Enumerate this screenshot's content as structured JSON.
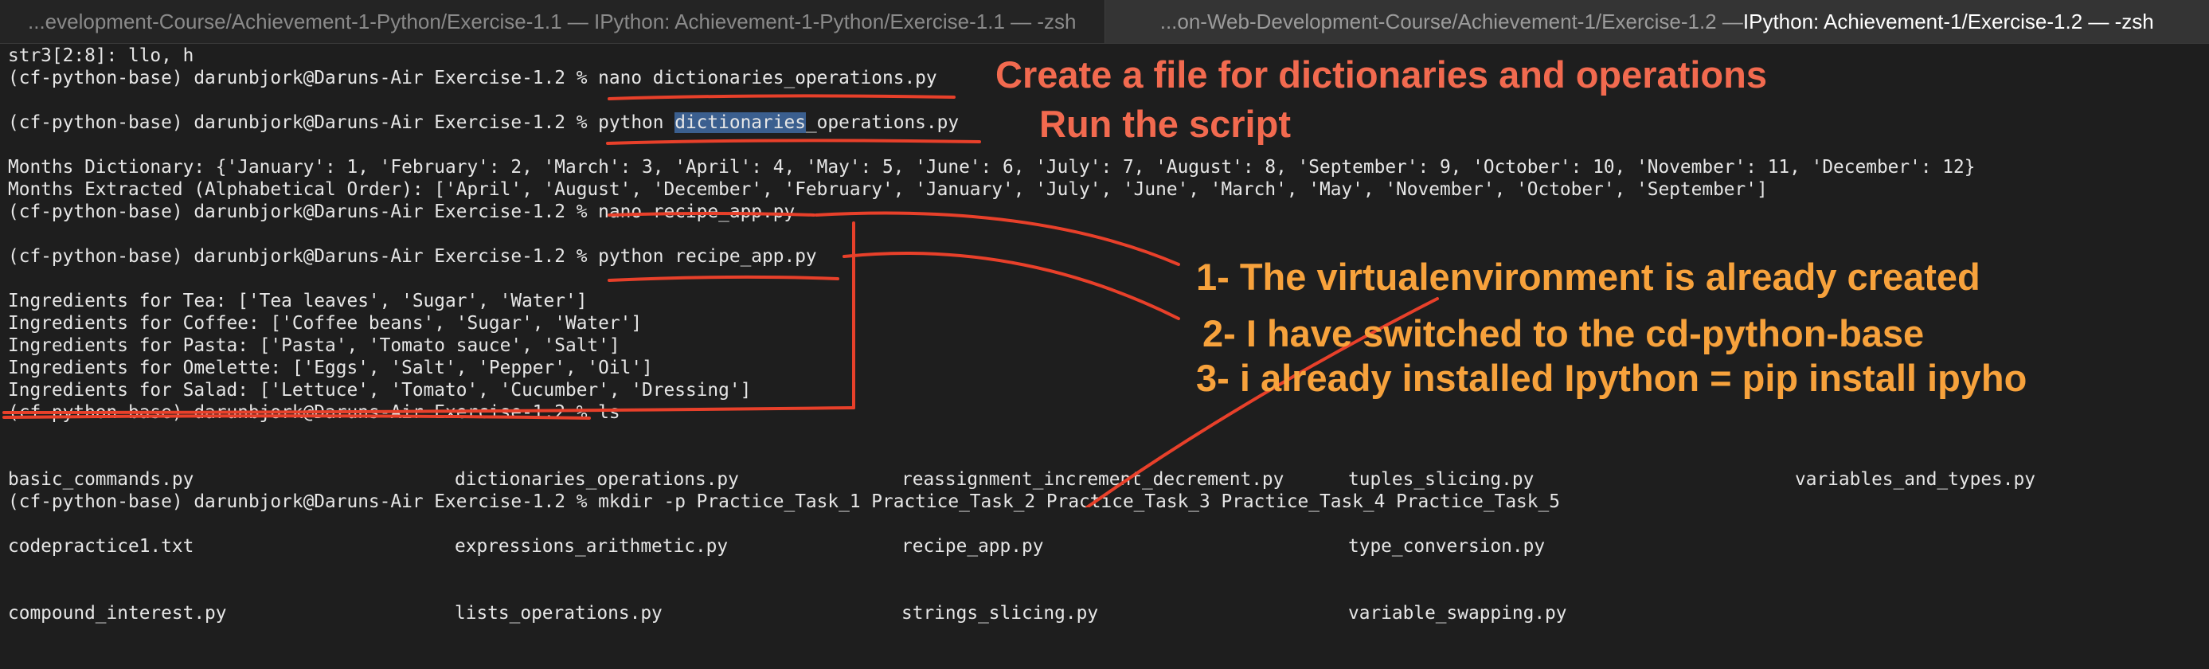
{
  "tabs": [
    {
      "label": "...evelopment-Course/Achievement-1-Python/Exercise-1.1 — IPython: Achievement-1-Python/Exercise-1.1 — -zsh",
      "active": false
    },
    {
      "label_prefix": "...on-Web-Development-Course/Achievement-1/Exercise-1.2 — ",
      "label_main": "IPython: Achievement-1/Exercise-1.2 — -zsh",
      "active": true
    }
  ],
  "terminal": {
    "prompt": "(cf-python-base) darunbjork@Daruns-Air Exercise-1.2 % ",
    "line_str3": "str3[2:8]: llo, h",
    "cmd_nano_dict": "nano dictionaries_operations.py",
    "cmd_python_pre": "python ",
    "cmd_python_sel": "dictionaries",
    "cmd_python_post": "_operations.py",
    "months_dict": "Months Dictionary: {'January': 1, 'February': 2, 'March': 3, 'April': 4, 'May': 5, 'June': 6, 'July': 7, 'August': 8, 'September': 9, 'October': 10, 'November': 11, 'December': 12}",
    "months_extracted": "Months Extracted (Alphabetical Order): ['April', 'August', 'December', 'February', 'January', 'July', 'June', 'March', 'May', 'November', 'October', 'September']",
    "cmd_nano_recipe": "nano recipe_app.py",
    "cmd_python_recipe": "python recipe_app.py",
    "ingredients": [
      "Ingredients for Tea: ['Tea leaves', 'Sugar', 'Water']",
      "Ingredients for Coffee: ['Coffee beans', 'Sugar', 'Water']",
      "Ingredients for Pasta: ['Pasta', 'Tomato sauce', 'Salt']",
      "Ingredients for Omelette: ['Eggs', 'Salt', 'Pepper', 'Oil']",
      "Ingredients for Salad: ['Lettuce', 'Tomato', 'Cucumber', 'Dressing']"
    ],
    "cmd_ls": "ls",
    "ls_columns": [
      [
        "basic_commands.py",
        "codepractice1.txt",
        "compound_interest.py"
      ],
      [
        "dictionaries_operations.py",
        "expressions_arithmetic.py",
        "lists_operations.py"
      ],
      [
        "reassignment_increment_decrement.py",
        "recipe_app.py",
        "strings_slicing.py"
      ],
      [
        "tuples_slicing.py",
        "type_conversion.py",
        "variable_swapping.py"
      ],
      [
        "variables_and_types.py"
      ]
    ],
    "cmd_mkdir": "mkdir -p Practice_Task_1 Practice_Task_2 Practice_Task_3 Practice_Task_4 Practice_Task_5"
  },
  "annotations": {
    "create_file": "Create a file for dictionaries and operations",
    "run_script": "Run the script",
    "note1": "1- The virtualenvironment is already created",
    "note2": "2- I have switched to the cd-python-base",
    "note3": "3- i already installed Ipython = pip install ipyho"
  },
  "colors": {
    "background": "#1e1e1e",
    "text": "#e6e6e6",
    "annotation_red": "#f26a4f",
    "annotation_orange": "#f7a23c",
    "ink": "#e8402a",
    "selection": "#3b5f8f"
  }
}
